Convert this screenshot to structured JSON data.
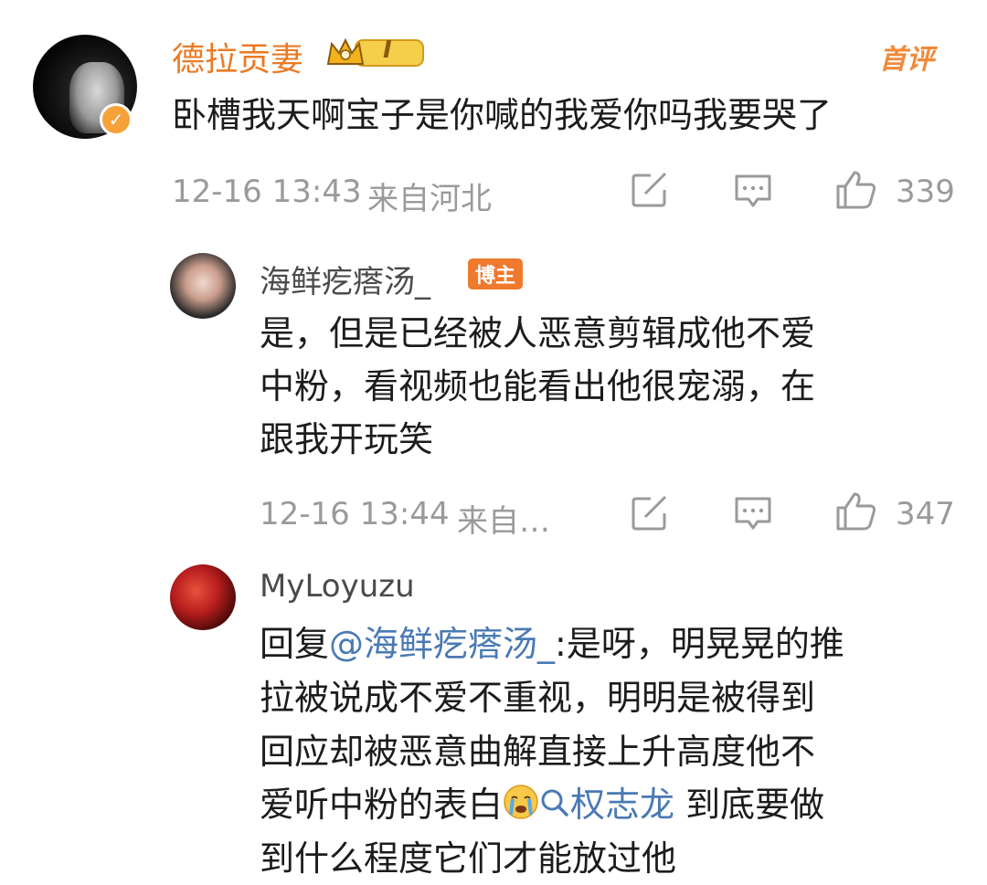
{
  "comments": [
    {
      "username": "德拉贡妻",
      "level_badge": "I",
      "tag": "首评",
      "text": "卧槽我天啊宝子是你喊的我爱你吗我要哭了",
      "time": "12-16 13:43",
      "location": "来自河北",
      "likes": "339"
    },
    {
      "username": "海鲜疙瘩汤_",
      "badge": "博主",
      "text_lines": [
        "是，但是已经被人恶意剪辑成他不爱",
        "中粉，看视频也能看出他很宠溺，在",
        "跟我开玩笑"
      ],
      "time": "12-16 13:44",
      "location": "来自…",
      "likes": "347"
    },
    {
      "username": "MyLoyuzu",
      "reply_prefix": "回复",
      "mention": "@海鲜疙瘩汤_",
      "line1_rest": ":是呀，明晃晃的推",
      "line2": "拉被说成不爱不重视，明明是被得到",
      "line3": "回应却被恶意曲解直接上升高度他不",
      "line4_pre": "爱听中粉的表白",
      "topic": "权志龙",
      "line4_post": " 到底要做",
      "line5": "到什么程度它们才能放过他"
    }
  ],
  "colors": {
    "username_accent": "#eb7a24",
    "link": "#4a79b4",
    "meta_gray": "#9a9a9a"
  },
  "icons": [
    "share-icon",
    "comment-icon",
    "like-icon",
    "crying-emoji-icon",
    "search-icon",
    "verified-icon",
    "crown-icon"
  ]
}
